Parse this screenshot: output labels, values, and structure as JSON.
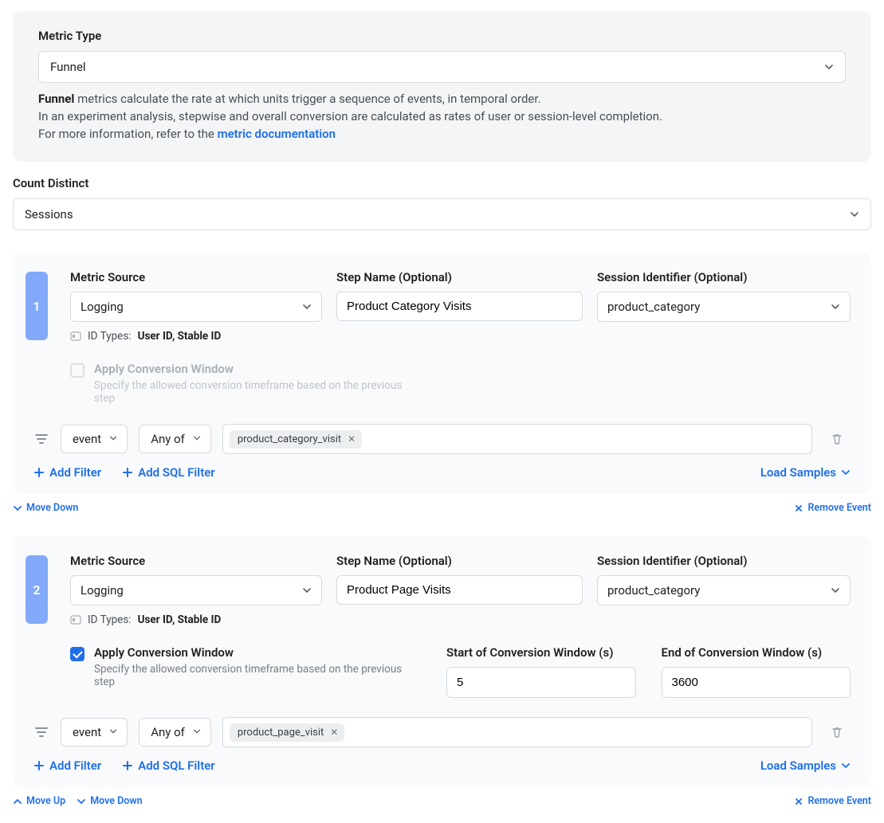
{
  "metric_type": {
    "label": "Metric Type",
    "value": "Funnel",
    "help_bold": "Funnel",
    "help_text_1": " metrics calculate the rate at which units trigger a sequence of events, in temporal order.",
    "help_text_2": "In an experiment analysis, stepwise and overall conversion are calculated as rates of user or session-level completion.",
    "help_text_3_prefix": "For more information, refer to the ",
    "help_link": "metric documentation"
  },
  "count_distinct": {
    "label": "Count Distinct",
    "value": "Sessions"
  },
  "labels": {
    "metric_source": "Metric Source",
    "step_name": "Step Name (Optional)",
    "session_identifier": "Session Identifier (Optional)",
    "id_types_prefix": "ID Types:",
    "apply_conv": "Apply Conversion Window",
    "apply_conv_sub": "Specify the allowed conversion timeframe based on the previous step",
    "conv_start": "Start of Conversion Window (s)",
    "conv_end": "End of Conversion Window (s)",
    "add_filter": "Add Filter",
    "add_sql_filter": "Add SQL Filter",
    "load_samples": "Load Samples",
    "move_down": "Move Down",
    "move_up": "Move Up",
    "remove_event": "Remove Event"
  },
  "steps": [
    {
      "number": "1",
      "metric_source": "Logging",
      "step_name": "Product Category Visits",
      "session_identifier": "product_category",
      "id_types": "User ID, Stable ID",
      "apply_conv_checked": false,
      "conv_start": "",
      "conv_end": "",
      "filter_field": "event",
      "filter_op": "Any of",
      "filter_chip": "product_category_visit",
      "has_move_up": false,
      "has_move_down": true
    },
    {
      "number": "2",
      "metric_source": "Logging",
      "step_name": "Product Page Visits",
      "session_identifier": "product_category",
      "id_types": "User ID, Stable ID",
      "apply_conv_checked": true,
      "conv_start": "5",
      "conv_end": "3600",
      "filter_field": "event",
      "filter_op": "Any of",
      "filter_chip": "product_page_visit",
      "has_move_up": true,
      "has_move_down": true
    }
  ]
}
